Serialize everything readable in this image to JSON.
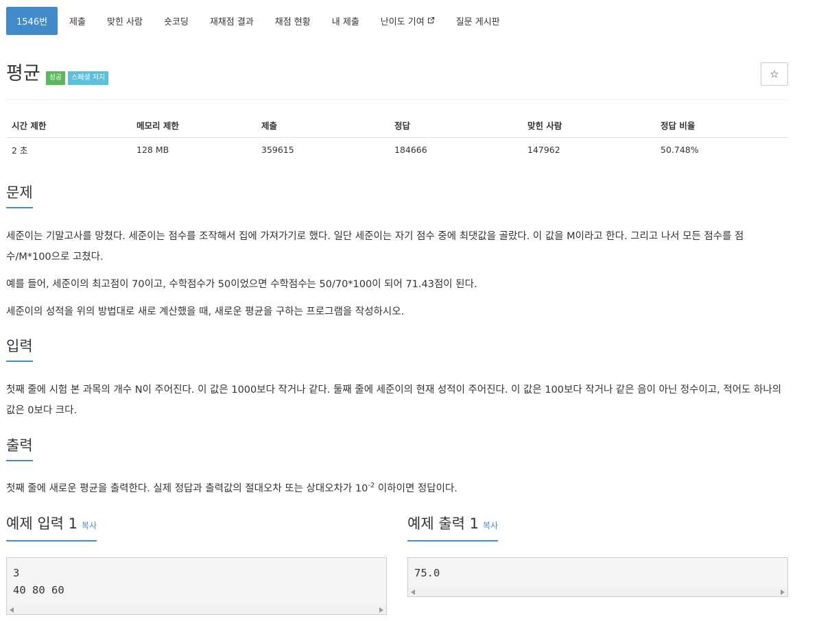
{
  "tabs": [
    {
      "label": "1546번",
      "active": true
    },
    {
      "label": "제출"
    },
    {
      "label": "맞힌 사람"
    },
    {
      "label": "숏코딩"
    },
    {
      "label": "재채점 결과"
    },
    {
      "label": "채점 현황"
    },
    {
      "label": "내 제출"
    },
    {
      "label": "난이도 기여",
      "icon": "external-link-icon"
    },
    {
      "label": "질문 게시판"
    }
  ],
  "problem": {
    "title": "평균",
    "badges": {
      "success": "성공",
      "special": "스페셜 저지"
    },
    "star_icon": "☆"
  },
  "info_table": {
    "headers": [
      "시간 제한",
      "메모리 제한",
      "제출",
      "정답",
      "맞힌 사람",
      "정답 비율"
    ],
    "values": [
      "2 초",
      "128 MB",
      "359615",
      "184666",
      "147962",
      "50.748%"
    ]
  },
  "sections": {
    "description": {
      "heading": "문제",
      "paragraphs": [
        "세준이는 기말고사를 망쳤다. 세준이는 점수를 조작해서 집에 가져가기로 했다. 일단 세준이는 자기 점수 중에 최댓값을 골랐다. 이 값을 M이라고 한다. 그리고 나서 모든 점수를 점수/M*100으로 고쳤다.",
        "예를 들어, 세준이의 최고점이 70이고, 수학점수가 50이었으면 수학점수는 50/70*100이 되어 71.43점이 된다.",
        "세준이의 성적을 위의 방법대로 새로 계산했을 때, 새로운 평균을 구하는 프로그램을 작성하시오."
      ]
    },
    "input": {
      "heading": "입력",
      "text": "첫째 줄에 시험 본 과목의 개수 N이 주어진다. 이 값은 1000보다 작거나 같다. 둘째 줄에 세준이의 현재 성적이 주어진다. 이 값은 100보다 작거나 같은 음이 아닌 정수이고, 적어도 하나의 값은 0보다 크다."
    },
    "output": {
      "heading": "출력",
      "text_before": "첫째 줄에 새로운 평균을 출력한다. 실제 정답과 출력값의 절대오차 또는 상대오차가 10",
      "sup": "-2",
      "text_after": " 이하이면 정답이다."
    }
  },
  "samples": {
    "input": {
      "heading": "예제 입력 1",
      "copy_label": "복사",
      "content": "3\n40 80 60"
    },
    "output": {
      "heading": "예제 출력 1",
      "copy_label": "복사",
      "content": "75.0"
    }
  }
}
